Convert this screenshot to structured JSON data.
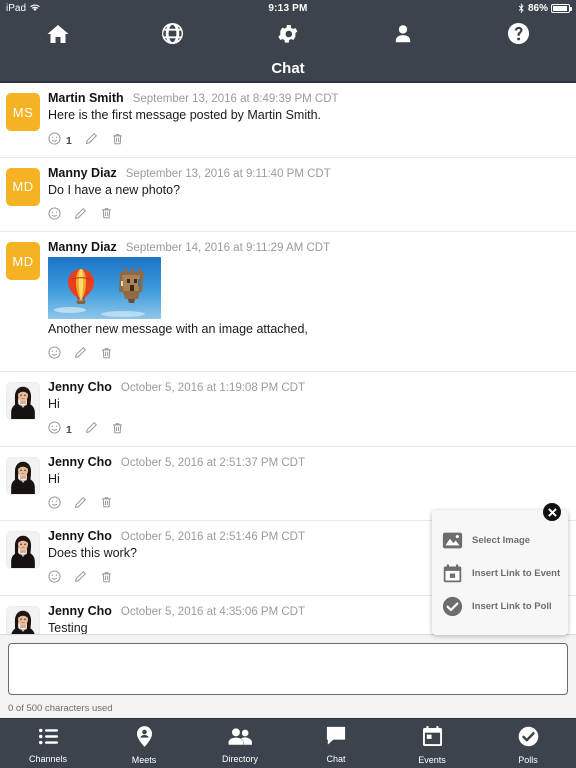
{
  "statusbar": {
    "device": "iPad",
    "wifi_icon": "wifi-icon",
    "time": "9:13 PM",
    "bluetooth_icon": "bluetooth-icon",
    "battery_percent": "86%",
    "battery_icon": "battery-icon"
  },
  "topnav": {
    "items": [
      {
        "name": "home",
        "icon": "home-icon"
      },
      {
        "name": "globe",
        "icon": "globe-icon"
      },
      {
        "name": "settings",
        "icon": "gear-icon"
      },
      {
        "name": "profile",
        "icon": "person-icon"
      },
      {
        "name": "help",
        "icon": "question-mark-icon"
      }
    ]
  },
  "title": "Chat",
  "messages": [
    {
      "author": "Martin Smith",
      "timestamp": "September 13, 2016 at 8:49:39 PM CDT",
      "text": "Here is the first message posted by Martin Smith.",
      "avatar_type": "initials",
      "avatar_initials": "MS",
      "avatar_color": "#f5b324",
      "reaction_count": "1",
      "has_image": false
    },
    {
      "author": "Manny Diaz",
      "timestamp": "September 13, 2016 at 9:11:40 PM CDT",
      "text": "Do I have a new photo?",
      "avatar_type": "initials",
      "avatar_initials": "MD",
      "avatar_color": "#f5b324",
      "reaction_count": "",
      "has_image": false
    },
    {
      "author": "Manny Diaz",
      "timestamp": "September 14, 2016 at 9:11:29 AM CDT",
      "text": "Another new message with an image attached,",
      "avatar_type": "initials",
      "avatar_initials": "MD",
      "avatar_color": "#f5b324",
      "reaction_count": "",
      "has_image": true,
      "image_alt": "hot-air-balloons-photo"
    },
    {
      "author": "Jenny Cho",
      "timestamp": "October 5, 2016 at 1:19:08 PM CDT",
      "text": "Hi",
      "avatar_type": "photo",
      "avatar_initials": "",
      "avatar_color": "",
      "reaction_count": "1",
      "has_image": false
    },
    {
      "author": "Jenny Cho",
      "timestamp": "October 5, 2016 at 2:51:37 PM CDT",
      "text": "Hi",
      "avatar_type": "photo",
      "avatar_initials": "",
      "avatar_color": "",
      "reaction_count": "",
      "has_image": false
    },
    {
      "author": "Jenny Cho",
      "timestamp": "October 5, 2016 at 2:51:46 PM CDT",
      "text": "Does this work?",
      "avatar_type": "photo",
      "avatar_initials": "",
      "avatar_color": "",
      "reaction_count": "",
      "has_image": false
    },
    {
      "author": "Jenny Cho",
      "timestamp": "October 5, 2016 at 4:35:06 PM CDT",
      "text": "Testing",
      "avatar_type": "photo",
      "avatar_initials": "",
      "avatar_color": "",
      "reaction_count": "",
      "has_image": false
    }
  ],
  "message_actions": {
    "react_icon": "smiley-face-icon",
    "edit_icon": "pencil-icon",
    "delete_icon": "trash-icon"
  },
  "composer": {
    "value": "",
    "placeholder": "",
    "char_count": "0 of 500 characters used"
  },
  "popup": {
    "close_icon": "close-icon",
    "items": [
      {
        "label": "Select Image",
        "icon": "image-icon"
      },
      {
        "label": "Insert Link to Event",
        "icon": "calendar-icon"
      },
      {
        "label": "Insert Link to Poll",
        "icon": "check-circle-icon"
      }
    ]
  },
  "tabbar": {
    "tabs": [
      {
        "label": "Channels",
        "icon": "list-icon"
      },
      {
        "label": "Meets",
        "icon": "map-pin-person-icon"
      },
      {
        "label": "Directory",
        "icon": "people-icon"
      },
      {
        "label": "Chat",
        "icon": "speech-bubble-icon"
      },
      {
        "label": "Events",
        "icon": "calendar-icon"
      },
      {
        "label": "Polls",
        "icon": "check-circle-icon"
      }
    ]
  },
  "colors": {
    "chrome": "#3c434c",
    "avatar_amber": "#f5b324",
    "body": "#ffffff",
    "composer_bg": "#f3f3f3"
  }
}
